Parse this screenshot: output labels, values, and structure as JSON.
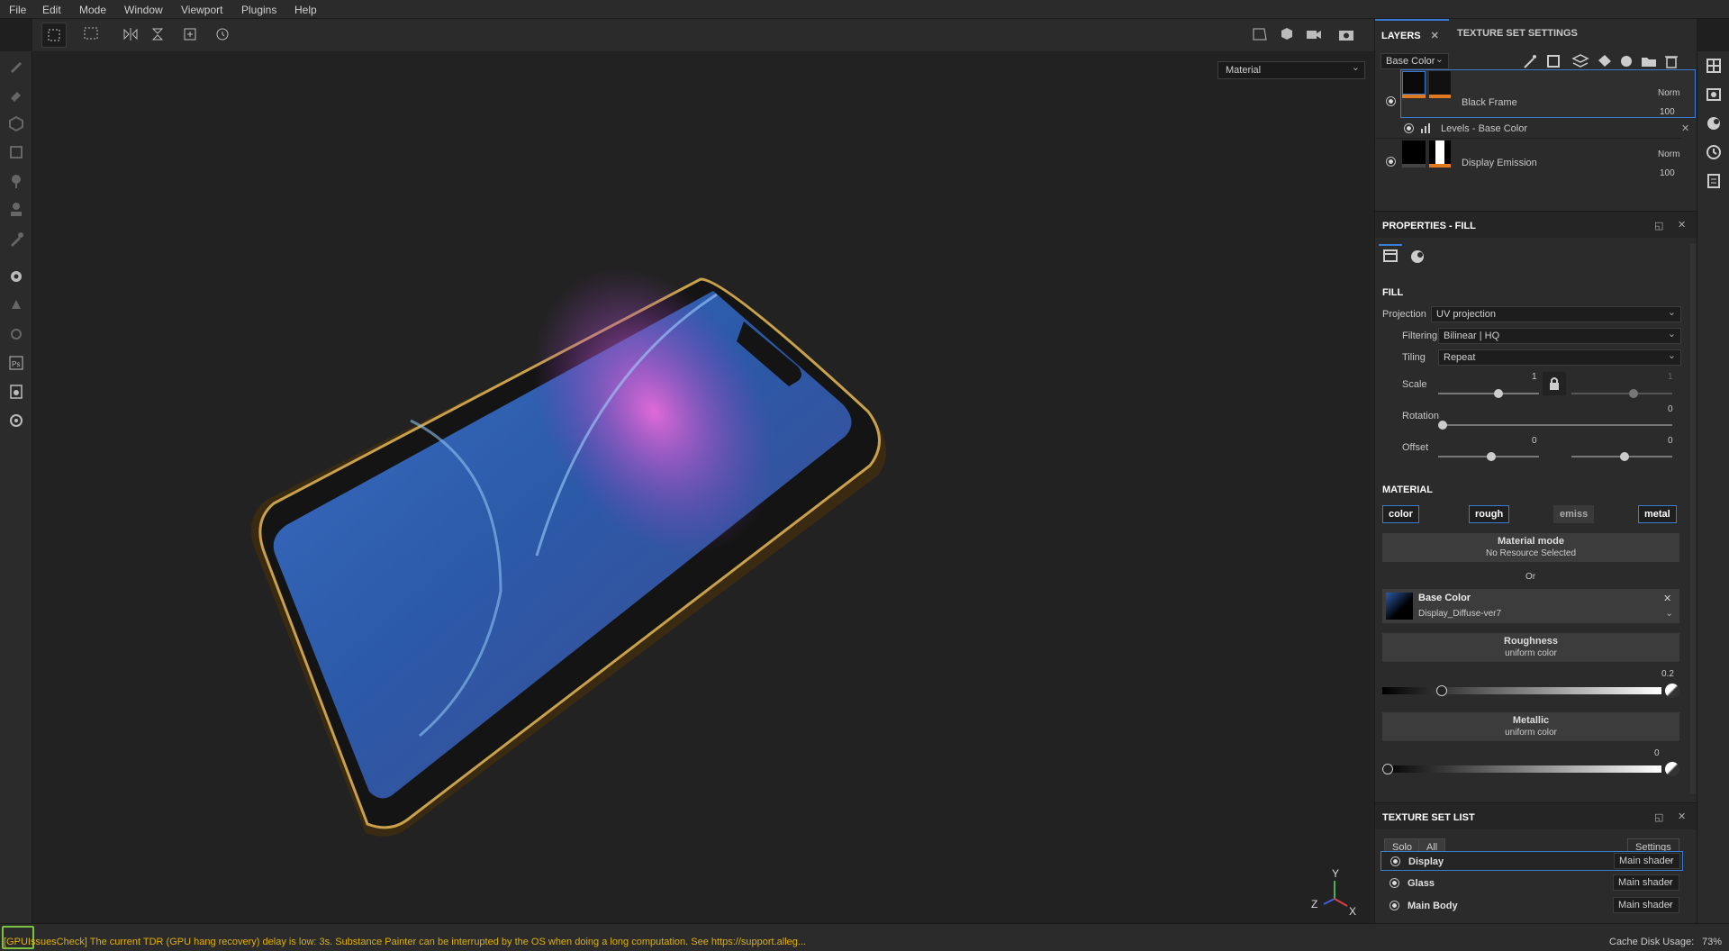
{
  "menu": [
    "File",
    "Edit",
    "Mode",
    "Window",
    "Viewport",
    "Plugins",
    "Help"
  ],
  "viewport": {
    "mode": "Material"
  },
  "axes": {
    "x": "X",
    "y": "Y",
    "z": "Z"
  },
  "layers_panel": {
    "tab_layers": "LAYERS",
    "tab_texture_set_settings": "TEXTURE SET SETTINGS",
    "channel": "Base Color",
    "layers": [
      {
        "name": "Black Frame",
        "blend": "Norm",
        "opacity": "100"
      },
      {
        "name": "Display Emission",
        "blend": "Norm",
        "opacity": "100"
      }
    ],
    "effect": {
      "name": "Levels - Base Color"
    }
  },
  "properties": {
    "title": "PROPERTIES - FILL",
    "fill_section": "FILL",
    "projection_label": "Projection",
    "projection_value": "UV projection",
    "filtering_label": "Filtering",
    "filtering_value": "Bilinear | HQ",
    "tiling_label": "Tiling",
    "tiling_value": "Repeat",
    "scale_label": "Scale",
    "scale_u": "1",
    "scale_v": "1",
    "rotation_label": "Rotation",
    "rotation_value": "0",
    "offset_label": "Offset",
    "offset_u": "0",
    "offset_v": "0",
    "material_section": "MATERIAL",
    "channels": [
      {
        "label": "color",
        "enabled": true
      },
      {
        "label": "rough",
        "enabled": true
      },
      {
        "label": "emiss",
        "enabled": false
      },
      {
        "label": "metal",
        "enabled": true
      }
    ],
    "material_mode_title": "Material mode",
    "material_mode_sub": "No Resource Selected",
    "or_label": "Or",
    "base_color_title": "Base Color",
    "base_color_resource": "Display_Diffuse-ver7",
    "roughness_title": "Roughness",
    "roughness_sub": "uniform color",
    "roughness_value": "0.2",
    "roughness_level": 0.2,
    "metallic_title": "Metallic",
    "metallic_sub": "uniform color",
    "metallic_value": "0",
    "metallic_level": 0
  },
  "texture_set_list": {
    "title": "TEXTURE SET LIST",
    "solo": "Solo",
    "all": "All",
    "settings": "Settings",
    "sets": [
      {
        "name": "Display",
        "shader": "Main shader"
      },
      {
        "name": "Glass",
        "shader": "Main shader"
      },
      {
        "name": "Main Body",
        "shader": "Main shader"
      }
    ]
  },
  "status": {
    "message": "[GPUIssuesCheck] The current TDR (GPU hang recovery) delay is low: 3s. Substance Painter can be interrupted by the OS when doing a long computation. See https://support.alleg...",
    "cache_label": "Cache Disk Usage:",
    "cache_value": "73%"
  },
  "colors": {
    "accent": "#3a7bd5",
    "warning": "#e0b000",
    "panel": "#2b2b2b"
  }
}
